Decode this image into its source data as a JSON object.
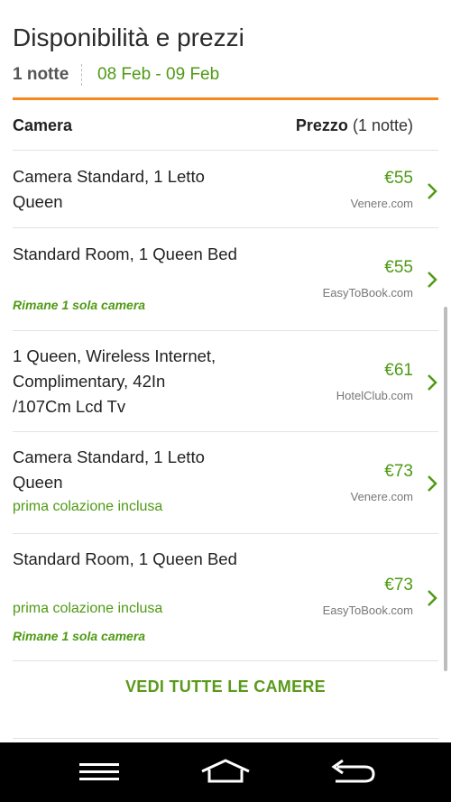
{
  "header": {
    "title": "Disponibilità e prezzi",
    "nights": "1 notte",
    "dates": "08 Feb - 09 Feb"
  },
  "table_header": {
    "camera": "Camera",
    "price_label": "Prezzo",
    "price_suffix": "(1 notte)"
  },
  "rooms": [
    {
      "name": "Camera Standard, 1 Letto Queen",
      "note": "",
      "warning": "",
      "price": "€55",
      "provider": "Venere.com"
    },
    {
      "name": "Standard Room, 1 Queen Bed",
      "note": "",
      "warning": "Rimane 1 sola camera",
      "price": "€55",
      "provider": "EasyToBook.com"
    },
    {
      "name": "1 Queen, Wireless Internet, Complimentary, 42In /107Cm Lcd Tv",
      "note": "",
      "warning": "",
      "price": "€61",
      "provider": "HotelClub.com"
    },
    {
      "name": "Camera Standard, 1 Letto Queen",
      "note": "prima colazione inclusa",
      "warning": "",
      "price": "€73",
      "provider": "Venere.com"
    },
    {
      "name": "Standard Room, 1 Queen Bed",
      "note": "prima colazione inclusa",
      "warning": "Rimane 1 sola camera",
      "price": "€73",
      "provider": "EasyToBook.com"
    }
  ],
  "see_all": "VEDI TUTTE LE CAMERE",
  "colors": {
    "accent_green": "#4f9a14",
    "divider_orange": "#f5891f",
    "navbar": "#000000"
  },
  "navbar": {
    "icons": [
      "menu-icon",
      "home-icon",
      "back-icon"
    ]
  }
}
